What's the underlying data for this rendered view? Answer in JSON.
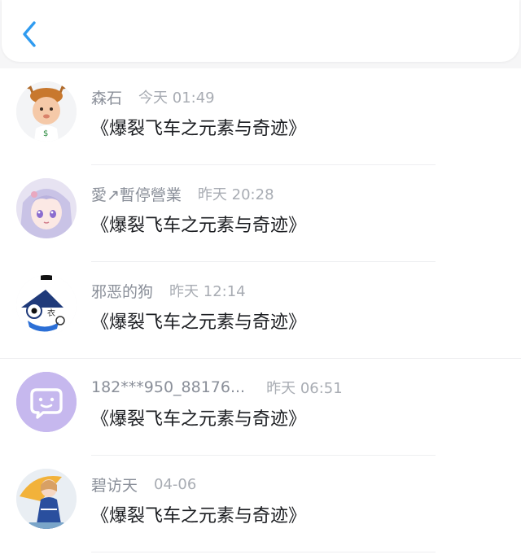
{
  "header": {
    "back_icon": "chevron-left-icon",
    "accent_color": "#2f9bf0"
  },
  "messages": [
    {
      "name": "森石",
      "time": "今天 01:49",
      "content": "《爆裂飞车之元素与奇迹》",
      "avatar": "reindeer-baby-avatar"
    },
    {
      "name": "愛↗暫停營業",
      "time": "昨天 20:28",
      "content": "《爆裂飞车之元素与奇迹》",
      "avatar": "anime-girl-avatar"
    },
    {
      "name": "邪恶的狗",
      "time": "昨天 12:14",
      "content": "《爆裂飞车之元素与奇迹》",
      "avatar": "cartoon-character-avatar"
    },
    {
      "name": "182***950_88176...",
      "time": "昨天 06:51",
      "content": "《爆裂飞车之元素与奇迹》",
      "avatar": "default-chat-avatar"
    },
    {
      "name": "碧访天",
      "time": "04-06",
      "content": "《爆裂飞车之元素与奇迹》",
      "avatar": "umbrella-girl-avatar"
    }
  ]
}
